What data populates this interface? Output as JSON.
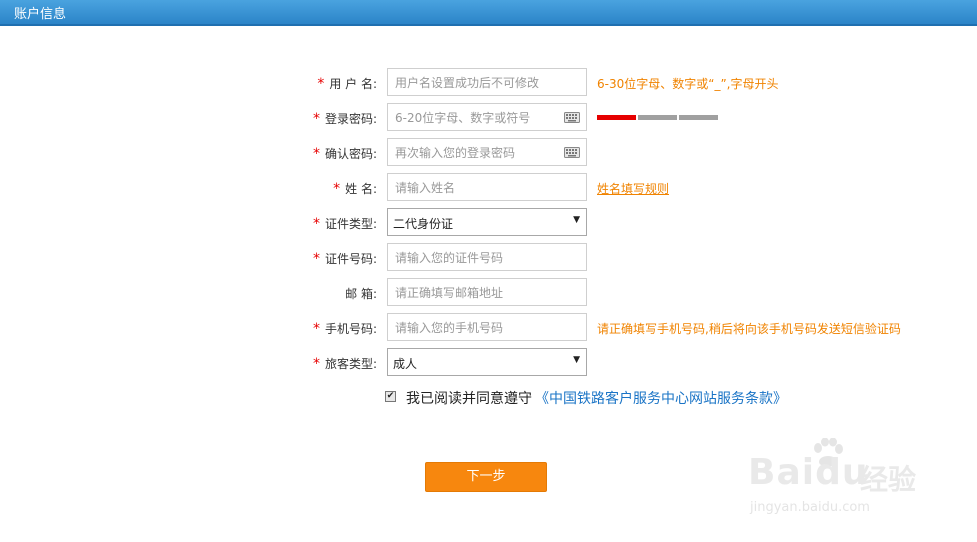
{
  "header": {
    "title": "账户信息"
  },
  "fields": [
    {
      "required": "*",
      "label": "用 户 名:",
      "placeholder": "用户名设置成功后不可修改",
      "hint": "6-30位字母、数字或“_”,字母开头"
    },
    {
      "required": "*",
      "label": "登录密码:",
      "placeholder": "6-20位字母、数字或符号",
      "icon": "keyboard-icon"
    },
    {
      "required": "*",
      "label": "确认密码:",
      "placeholder": "再次输入您的登录密码",
      "icon": "keyboard-icon"
    },
    {
      "required": "*",
      "label": "姓 名:",
      "placeholder": "请输入姓名",
      "link": "姓名填写规则"
    },
    {
      "required": "*",
      "label": "证件类型:",
      "value": "二代身份证"
    },
    {
      "required": "*",
      "label": "证件号码:",
      "placeholder": "请输入您的证件号码"
    },
    {
      "required": "",
      "label": "邮 箱:",
      "placeholder": "请正确填写邮箱地址"
    },
    {
      "required": "*",
      "label": "手机号码:",
      "placeholder": "请输入您的手机号码",
      "hint": "请正确填写手机号码,稍后将向该手机号码发送短信验证码"
    },
    {
      "required": "*",
      "label": "旅客类型:",
      "value": "成人"
    }
  ],
  "password_strength": {
    "levels": 3,
    "filled": 1,
    "colors": {
      "filled": "#e60000",
      "empty": "#a0a0a0"
    }
  },
  "agreement": {
    "checked": true,
    "text": "我已阅读并同意遵守",
    "link": "《中国铁路客户服务中心网站服务条款》"
  },
  "next_button": {
    "label": "下一步"
  },
  "watermark": {
    "brand": "Baidu",
    "cn": "经验",
    "url": "jingyan.baidu.com"
  },
  "colors": {
    "header": "#2b84c8",
    "accent": "#f7870e",
    "hint": "#f08300",
    "link": "#1a74c6",
    "required": "#e60000"
  }
}
